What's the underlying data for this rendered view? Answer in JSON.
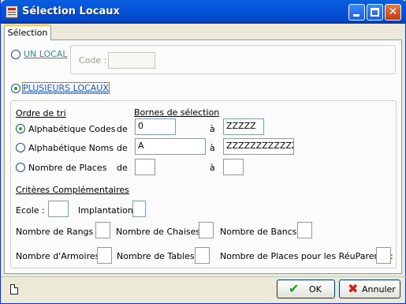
{
  "window": {
    "title": "Sélection Locaux"
  },
  "tabs": [
    {
      "label": "Sélection"
    }
  ],
  "un_local": {
    "label": "UN LOCAL",
    "code_label": "Code :",
    "code_value": ""
  },
  "plusieurs_locaux": {
    "label": "PLUSIEURS LOCAUX"
  },
  "ordre_tri": {
    "title": "Ordre de tri",
    "options": [
      {
        "label": "Alphabétique Codes",
        "selected": true
      },
      {
        "label": "Alphabétique Noms",
        "selected": false
      },
      {
        "label": "Nombre de Places",
        "selected": false
      }
    ]
  },
  "bornes": {
    "title": "Bornes de sélection",
    "de_label": "de",
    "a_label": "à",
    "rows": [
      {
        "from": "0",
        "to": "ZZZZZ"
      },
      {
        "from": "A",
        "to": "ZZZZZZZZZZZZ"
      },
      {
        "from": "",
        "to": ""
      }
    ]
  },
  "criteres": {
    "title": "Critères Complémentaires",
    "ecole": {
      "label": "Ecole :",
      "value": ""
    },
    "implantation": {
      "label": "Implantation :",
      "value": ""
    },
    "rangs": {
      "label": "Nombre de Rangs :",
      "value": ""
    },
    "chaises": {
      "label": "Nombre de Chaises :",
      "value": ""
    },
    "bancs": {
      "label": "Nombre de Bancs :",
      "value": ""
    },
    "armoires": {
      "label": "Nombre d'Armoires :",
      "value": ""
    },
    "tables": {
      "label": "Nombre de Tables :",
      "value": ""
    },
    "places_reu": {
      "label": "Nombre de Places pour les RéuParents :",
      "value": ""
    }
  },
  "buttons": {
    "ok": "OK",
    "cancel": "Annuler"
  },
  "icons": {
    "app": "app-icon",
    "ok": "checkmark-icon",
    "cancel": "red-x-icon",
    "status": "document-icon"
  },
  "colors": {
    "title_bar": "#0453d8",
    "face": "#ece9d8",
    "link": "#1a56c8",
    "radio_dot": "#21a121",
    "cancel_x": "#c8201c",
    "ok_check": "#1f9a1f"
  }
}
